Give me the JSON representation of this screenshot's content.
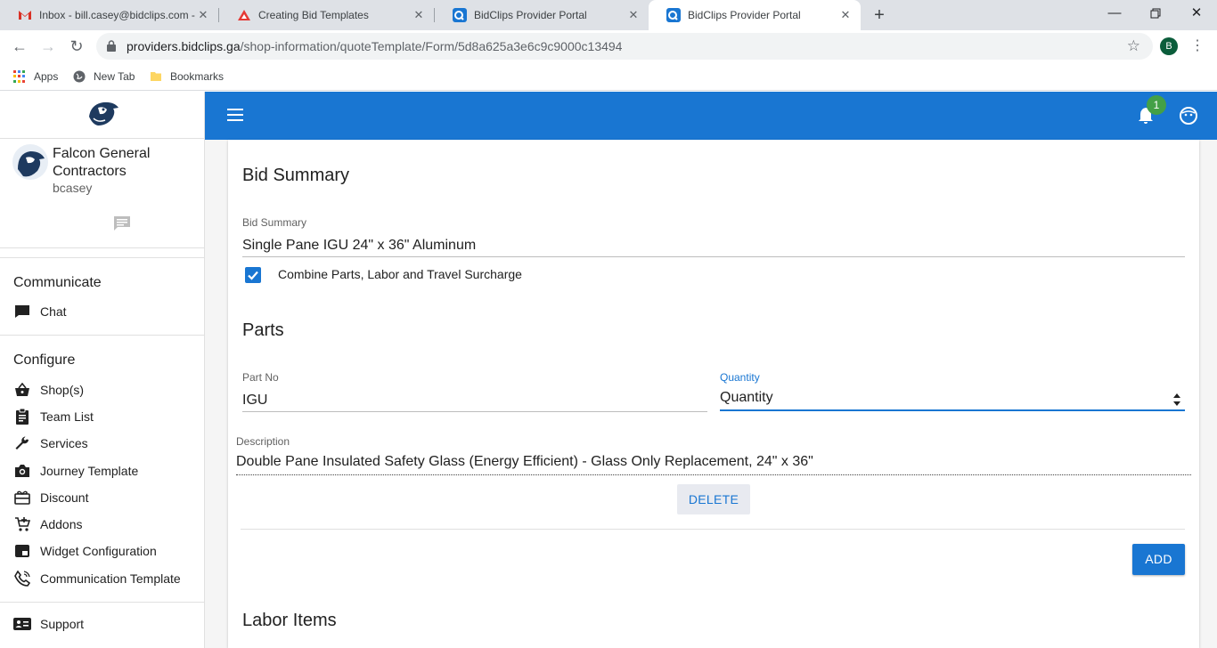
{
  "browser": {
    "tabs": [
      {
        "title": "Inbox - bill.casey@bidclips.com -",
        "icon": "gmail-icon"
      },
      {
        "title": "Creating Bid Templates",
        "icon": "drive-icon"
      },
      {
        "title": "BidClips Provider Portal",
        "icon": "bidclips-icon"
      },
      {
        "title": "BidClips Provider Portal",
        "icon": "bidclips-icon",
        "active": true
      }
    ],
    "url_host": "providers.bidclips.ga",
    "url_path": "/shop-information/quoteTemplate/Form/5d8a625a3e6c9c9000c13494",
    "profile_initial": "B",
    "bookmarks": [
      "Apps",
      "New Tab",
      "Bookmarks"
    ]
  },
  "sidebar": {
    "company": "Falcon General Contractors",
    "username": "bcasey",
    "sections": [
      {
        "title": "Communicate",
        "items": [
          {
            "label": "Chat",
            "icon": "chat-icon"
          }
        ]
      },
      {
        "title": "Configure",
        "items": [
          {
            "label": "Shop(s)",
            "icon": "basket-icon"
          },
          {
            "label": "Team List",
            "icon": "clipboard-icon"
          },
          {
            "label": "Services",
            "icon": "wrench-icon"
          },
          {
            "label": "Journey Template",
            "icon": "camera-icon"
          },
          {
            "label": "Discount",
            "icon": "redeem-icon"
          },
          {
            "label": "Addons",
            "icon": "cart-plus-icon"
          },
          {
            "label": "Widget Configuration",
            "icon": "widget-icon"
          },
          {
            "label": "Communication Template",
            "icon": "phone-icon"
          }
        ]
      }
    ],
    "support": "Support"
  },
  "topbar": {
    "notification_count": "1",
    "colors": {
      "primary": "#1976d2",
      "badge": "#43a047"
    }
  },
  "form": {
    "bid_summary_heading": "Bid Summary",
    "bid_summary_label": "Bid Summary",
    "bid_summary_value": "Single Pane IGU 24\" x 36\" Aluminum",
    "combine_label": "Combine Parts, Labor and Travel Surcharge",
    "combine_checked": true,
    "parts_heading": "Parts",
    "part_no_label": "Part No",
    "part_no_value": "IGU",
    "quantity_label": "Quantity",
    "quantity_placeholder": "Quantity",
    "description_label": "Description",
    "description_value": "Double Pane Insulated Safety Glass (Energy Efficient) - Glass Only Replacement, 24\" x 36\"",
    "delete_label": "DELETE",
    "add_label": "ADD",
    "labor_heading": "Labor Items"
  }
}
